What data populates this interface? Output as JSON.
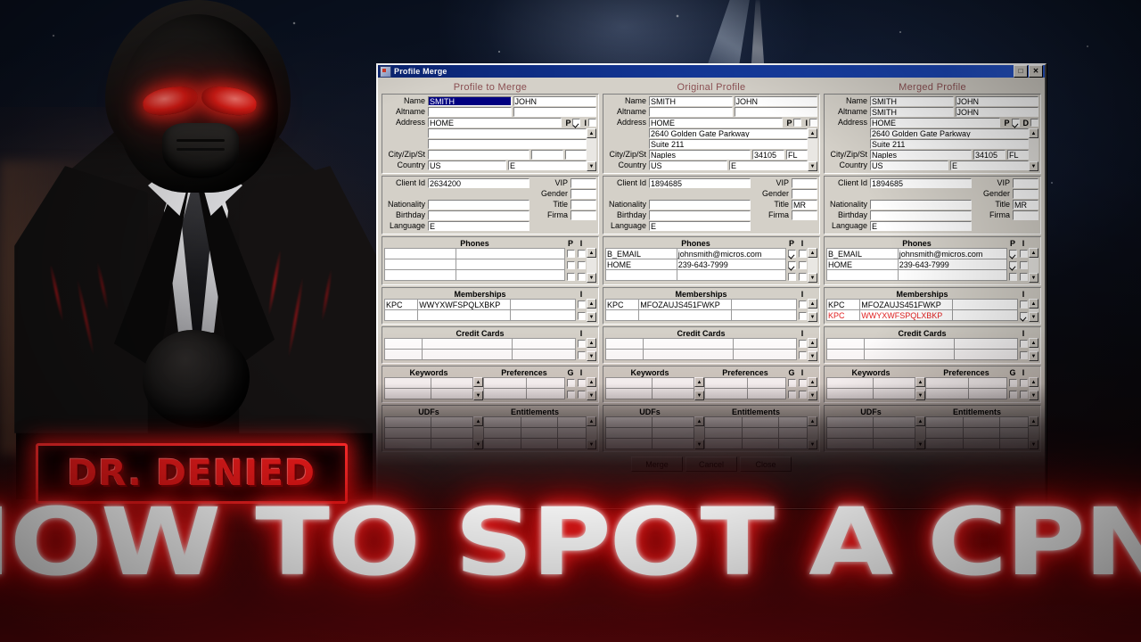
{
  "scene": {
    "brand_logo": "DR. DENIED",
    "headline": "HOW TO SPOT A CPN!",
    "accent_red": "#ef1d1d",
    "glow_red": "#ff2b2b"
  },
  "window": {
    "title": "Profile Merge",
    "icon": "profile-merge-icon",
    "buttons": {
      "maximize": "□",
      "close": "✕"
    }
  },
  "column_headers": {
    "left": "Profile to Merge",
    "middle": "Original Profile",
    "right": "Merged Profile"
  },
  "labels": {
    "name": "Name",
    "altname": "Altname",
    "address": "Address",
    "city_zip_st": "City/Zip/St",
    "country": "Country",
    "client_id": "Client Id",
    "nationality": "Nationality",
    "birthday": "Birthday",
    "language": "Language",
    "vip": "VIP",
    "gender": "Gender",
    "title": "Title",
    "firma": "Firma",
    "phones": "Phones",
    "memberships": "Memberships",
    "credit_cards": "Credit Cards",
    "keywords": "Keywords",
    "preferences": "Preferences",
    "udfs": "UDFs",
    "entitlements": "Entitlements",
    "col_p": "P",
    "col_i": "I",
    "col_d": "D",
    "col_g": "G"
  },
  "profiles": [
    {
      "key": "profile_to_merge",
      "name_last": "SMITH",
      "name_first": "JOHN",
      "name_last_selected": true,
      "altname_last": "",
      "altname_first": "",
      "address_type": "HOME",
      "address_p_checked": true,
      "address_second_flag_label": "I",
      "address_second_flag_checked": false,
      "address_line1": "",
      "address_line2": "",
      "city": "",
      "zip": "",
      "state": "",
      "country": "US",
      "country_code": "E",
      "client_id": "2634200",
      "vip": "",
      "gender": "",
      "nationality": "",
      "title": "",
      "birthday": "",
      "firma": "",
      "language": "E",
      "phones": [
        {
          "type": "",
          "number": "",
          "p": false,
          "i": false
        },
        {
          "type": "",
          "number": "",
          "p": false,
          "i": false
        },
        {
          "type": "",
          "number": "",
          "p": false,
          "i": false
        }
      ],
      "memberships": [
        {
          "program": "KPC",
          "number": "WWYXWFSPQLXB",
          "suffix": "KP",
          "extra": "",
          "i": false
        },
        {
          "program": "",
          "number": "",
          "suffix": "",
          "extra": "",
          "i": false
        }
      ],
      "credit_cards": [
        {
          "c1": "",
          "c2": "",
          "c3": "",
          "i": false
        },
        {
          "c1": "",
          "c2": "",
          "c3": "",
          "i": false
        }
      ],
      "keywords": [
        {
          "k1": "",
          "k2": ""
        },
        {
          "k1": "",
          "k2": ""
        }
      ],
      "preferences": [
        {
          "p1": "",
          "p2": "",
          "g": false,
          "i": false
        },
        {
          "p1": "",
          "p2": "",
          "g": false,
          "i": false
        }
      ],
      "udfs": [
        {
          "u1": "",
          "u2": ""
        },
        {
          "u1": "",
          "u2": ""
        },
        {
          "u1": "",
          "u2": ""
        }
      ],
      "entitlements": [
        {
          "e1": "",
          "e2": "",
          "e3": ""
        },
        {
          "e1": "",
          "e2": "",
          "e3": ""
        },
        {
          "e1": "",
          "e2": "",
          "e3": ""
        }
      ]
    },
    {
      "key": "original_profile",
      "name_last": "SMITH",
      "name_first": "JOHN",
      "name_last_selected": false,
      "altname_last": "",
      "altname_first": "",
      "address_type": "HOME",
      "address_p_checked": false,
      "address_second_flag_label": "I",
      "address_second_flag_checked": false,
      "address_line1": "2640 Golden Gate Parkway",
      "address_line2": "Suite 211",
      "city": "Naples",
      "zip": "34105",
      "state": "FL",
      "country": "US",
      "country_code": "E",
      "client_id": "1894685",
      "vip": "",
      "gender": "",
      "nationality": "",
      "title": "MR",
      "birthday": "",
      "firma": "",
      "language": "E",
      "phones": [
        {
          "type": "B_EMAIL",
          "number": "johnsmith@micros.com",
          "p": true,
          "i": false
        },
        {
          "type": "HOME",
          "number": "239-643-7999",
          "p": true,
          "i": false
        },
        {
          "type": "",
          "number": "",
          "p": false,
          "i": false
        }
      ],
      "memberships": [
        {
          "program": "KPC",
          "number": "MFOZAUJS451FW",
          "suffix": "KP",
          "extra": "",
          "i": false
        },
        {
          "program": "",
          "number": "",
          "suffix": "",
          "extra": "",
          "i": false
        }
      ],
      "credit_cards": [
        {
          "c1": "",
          "c2": "",
          "c3": "",
          "i": false
        },
        {
          "c1": "",
          "c2": "",
          "c3": "",
          "i": false
        }
      ],
      "keywords": [
        {
          "k1": "",
          "k2": ""
        },
        {
          "k1": "",
          "k2": ""
        }
      ],
      "preferences": [
        {
          "p1": "",
          "p2": "",
          "g": false,
          "i": false
        },
        {
          "p1": "",
          "p2": "",
          "g": false,
          "i": false
        }
      ],
      "udfs": [
        {
          "u1": "",
          "u2": ""
        },
        {
          "u1": "",
          "u2": ""
        },
        {
          "u1": "",
          "u2": ""
        }
      ],
      "entitlements": [
        {
          "e1": "",
          "e2": "",
          "e3": ""
        },
        {
          "e1": "",
          "e2": "",
          "e3": ""
        },
        {
          "e1": "",
          "e2": "",
          "e3": ""
        }
      ]
    },
    {
      "key": "merged_profile",
      "name_last": "SMITH",
      "name_first": "JOHN",
      "name_last_selected": false,
      "altname_last": "SMITH",
      "altname_first": "JOHN",
      "address_type": "HOME",
      "address_p_checked": true,
      "address_second_flag_label": "D",
      "address_second_flag_checked": false,
      "address_line1": "2640 Golden Gate Parkway",
      "address_line2": "Suite 211",
      "city": "Naples",
      "zip": "34105",
      "state": "FL",
      "country": "US",
      "country_code": "E",
      "client_id": "1894685",
      "vip": "",
      "gender": "",
      "nationality": "",
      "title": "MR",
      "birthday": "",
      "firma": "",
      "language": "E",
      "phones": [
        {
          "type": "B_EMAIL",
          "number": "johnsmith@micros.com",
          "p": true,
          "i": false
        },
        {
          "type": "HOME",
          "number": "239-643-7999",
          "p": true,
          "i": false
        },
        {
          "type": "",
          "number": "",
          "p": false,
          "i": false
        }
      ],
      "memberships": [
        {
          "program": "KPC",
          "number": "MFOZAUJS451FW",
          "suffix": "KP",
          "extra": "",
          "i": false,
          "highlight": false
        },
        {
          "program": "KPC",
          "number": "WWYXWFSPQLXB",
          "suffix": "KP",
          "extra": "",
          "i": true,
          "highlight": true
        }
      ],
      "credit_cards": [
        {
          "c1": "",
          "c2": "",
          "c3": "",
          "i": false
        },
        {
          "c1": "",
          "c2": "",
          "c3": "",
          "i": false
        }
      ],
      "keywords": [
        {
          "k1": "",
          "k2": ""
        },
        {
          "k1": "",
          "k2": ""
        }
      ],
      "preferences": [
        {
          "p1": "",
          "p2": "",
          "g": false,
          "i": false
        },
        {
          "p1": "",
          "p2": "",
          "g": false,
          "i": false
        }
      ],
      "udfs": [
        {
          "u1": "",
          "u2": ""
        },
        {
          "u1": "",
          "u2": ""
        },
        {
          "u1": "",
          "u2": ""
        }
      ],
      "entitlements": [
        {
          "e1": "",
          "e2": "",
          "e3": ""
        },
        {
          "e1": "",
          "e2": "",
          "e3": ""
        },
        {
          "e1": "",
          "e2": "",
          "e3": ""
        }
      ]
    }
  ],
  "footer_buttons": [
    {
      "label": "Merge"
    },
    {
      "label": "Cancel"
    },
    {
      "label": "Close"
    }
  ]
}
